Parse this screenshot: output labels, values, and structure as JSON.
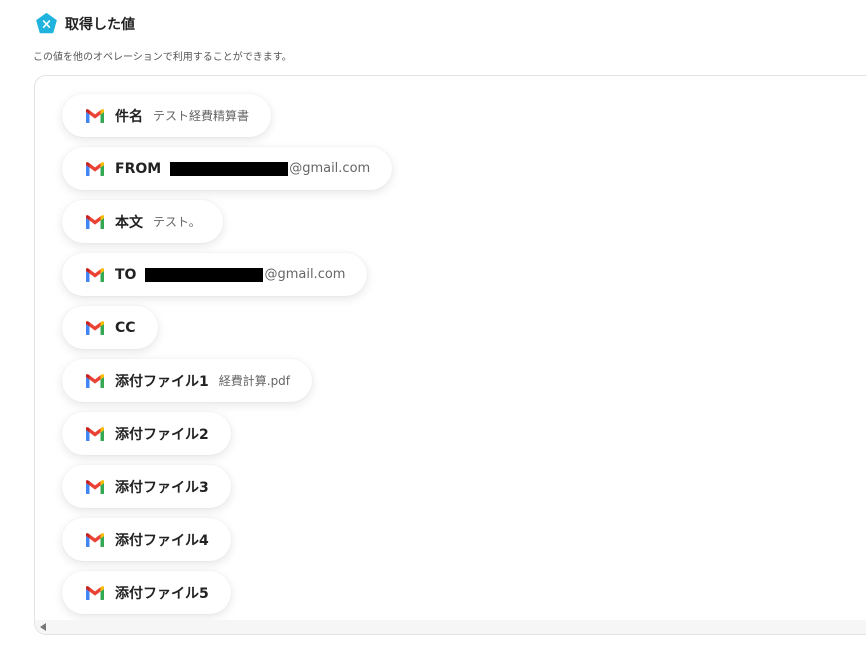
{
  "header": {
    "title": "取得した値",
    "icon": "x-badge-icon"
  },
  "subtitle": "この値を他のオペレーションで利用することができます。",
  "colors": {
    "accent": "#20b3de",
    "gmail_red": "#ea4335",
    "gmail_blue": "#4285f4",
    "gmail_green": "#34a853",
    "gmail_yellow": "#fbbc04"
  },
  "fields": [
    {
      "label": "件名",
      "value": "テスト経費精算書"
    },
    {
      "label": "FROM",
      "value": "",
      "suffix": "@gmail.com",
      "redacted": true
    },
    {
      "label": "本文",
      "value": "テスト。"
    },
    {
      "label": "TO",
      "value": "",
      "suffix": "@gmail.com",
      "redacted": true
    },
    {
      "label": "CC",
      "value": ""
    },
    {
      "label": "添付ファイル1",
      "value": "経費計算.pdf"
    },
    {
      "label": "添付ファイル2",
      "value": ""
    },
    {
      "label": "添付ファイル3",
      "value": ""
    },
    {
      "label": "添付ファイル4",
      "value": ""
    },
    {
      "label": "添付ファイル5",
      "value": ""
    }
  ]
}
